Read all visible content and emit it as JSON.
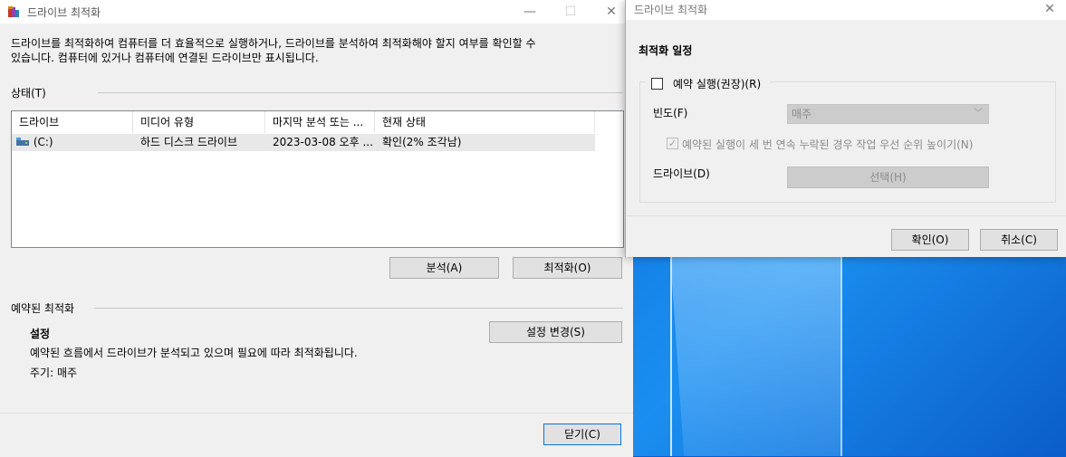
{
  "main": {
    "title": "드라이브 최적화",
    "description_line1": "드라이브를 최적화하여 컴퓨터를 더 효율적으로 실행하거나, 드라이브를 분석하여 최적화해야 할지 여부를 확인할 수",
    "description_line2": "있습니다. 컴퓨터에 있거나 컴퓨터에 연결된 드라이브만 표시됩니다.",
    "status_label": "상태(T)",
    "columns": [
      "드라이브",
      "미디어 유형",
      "마지막 분석 또는 ...",
      "현재 상태"
    ],
    "rows": [
      {
        "drive": "(C:)",
        "media": "하드 디스크 드라이브",
        "last": "2023-03-08 오후 ...",
        "state": "확인(2% 조각남)"
      }
    ],
    "analyze_button": "분석(A)",
    "optimize_button": "최적화(O)",
    "scheduled_label": "예약된 최적화",
    "settings_title": "설정",
    "change_settings_button": "설정 변경(S)",
    "settings_desc": "예약된 흐름에서 드라이브가 분석되고 있으며 필요에 따라 최적화됩니다.",
    "frequency_text": "주기: 매주",
    "close_button": "닫기(C)"
  },
  "dialog": {
    "title": "드라이브 최적화",
    "heading": "최적화 일정",
    "run_scheduled_label": "예약 실행(권장)(R)",
    "frequency_label": "빈도(F)",
    "frequency_value": "매주",
    "notify_label": "예약된 실행이 세 번 연속 누락된 경우 작업 우선 순위 높이기(N)",
    "drives_label": "드라이브(D)",
    "choose_button": "선택(H)",
    "ok_button": "확인(O)",
    "cancel_button": "취소(C)"
  },
  "colors": {
    "accent": "#0078d7",
    "window_bg": "#f0f0f0",
    "selected_row": "#e8e8e8"
  }
}
